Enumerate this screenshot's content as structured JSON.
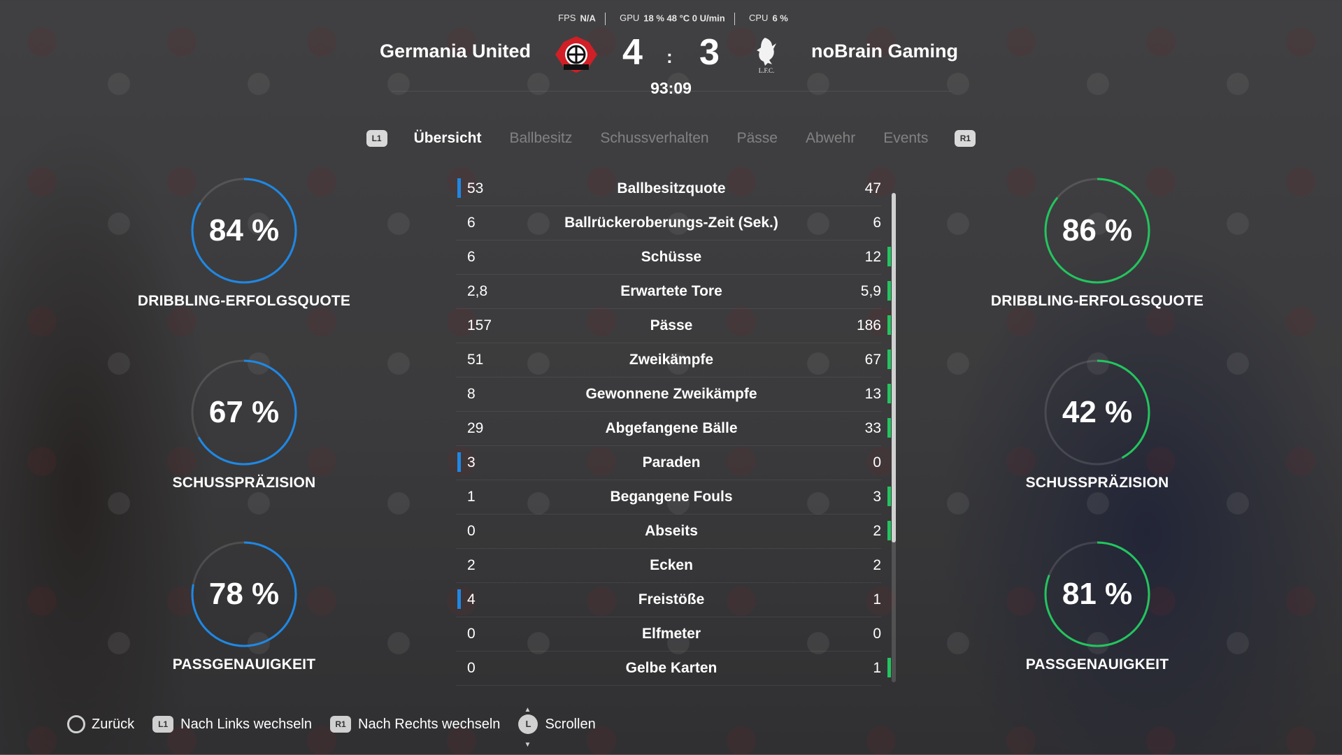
{
  "perf": {
    "fps_label": "FPS",
    "fps_value": "N/A",
    "gpu_label": "GPU",
    "gpu_value": "18 %  48 °C  0 U/min",
    "cpu_label": "CPU",
    "cpu_value": "6 %"
  },
  "match": {
    "home_team": "Germania United",
    "away_team": "noBrain Gaming",
    "home_score": "4",
    "away_score": "3",
    "separator": ":",
    "clock": "93:09",
    "home_crest_icon": "bayer-leverkusen-crest-icon",
    "away_crest_icon": "liverpool-liverbird-crest-icon",
    "away_crest_text": "L.F.C."
  },
  "tabs": {
    "left_button": "L1",
    "right_button": "R1",
    "items": [
      "Übersicht",
      "Ballbesitz",
      "Schussverhalten",
      "Pässe",
      "Abwehr",
      "Events"
    ],
    "active": "Übersicht"
  },
  "home_rings": [
    {
      "value": "84 %",
      "fraction": 0.84,
      "label": "DRIBBLING-ERFOLGSQUOTE"
    },
    {
      "value": "67 %",
      "fraction": 0.67,
      "label": "SCHUSSPRÄZISION"
    },
    {
      "value": "78 %",
      "fraction": 0.78,
      "label": "PASSGENAUIGKEIT"
    }
  ],
  "away_rings": [
    {
      "value": "86 %",
      "fraction": 0.86,
      "label": "DRIBBLING-ERFOLGSQUOTE"
    },
    {
      "value": "42 %",
      "fraction": 0.42,
      "label": "SCHUSSPRÄZISION"
    },
    {
      "value": "81 %",
      "fraction": 0.81,
      "label": "PASSGENAUIGKEIT"
    }
  ],
  "colors": {
    "home": "#1e88e5",
    "away": "#22c55e"
  },
  "stats": [
    {
      "name": "Ballbesitzquote",
      "home": "53",
      "away": "47",
      "leader": "home"
    },
    {
      "name": "Ballrückeroberungs-Zeit (Sek.)",
      "home": "6",
      "away": "6",
      "leader": ""
    },
    {
      "name": "Schüsse",
      "home": "6",
      "away": "12",
      "leader": "away"
    },
    {
      "name": "Erwartete Tore",
      "home": "2,8",
      "away": "5,9",
      "leader": "away"
    },
    {
      "name": "Pässe",
      "home": "157",
      "away": "186",
      "leader": "away"
    },
    {
      "name": "Zweikämpfe",
      "home": "51",
      "away": "67",
      "leader": "away"
    },
    {
      "name": "Gewonnene Zweikämpfe",
      "home": "8",
      "away": "13",
      "leader": "away"
    },
    {
      "name": "Abgefangene Bälle",
      "home": "29",
      "away": "33",
      "leader": "away"
    },
    {
      "name": "Paraden",
      "home": "3",
      "away": "0",
      "leader": "home"
    },
    {
      "name": "Begangene Fouls",
      "home": "1",
      "away": "3",
      "leader": "away"
    },
    {
      "name": "Abseits",
      "home": "0",
      "away": "2",
      "leader": "away"
    },
    {
      "name": "Ecken",
      "home": "2",
      "away": "2",
      "leader": ""
    },
    {
      "name": "Freistöße",
      "home": "4",
      "away": "1",
      "leader": "home"
    },
    {
      "name": "Elfmeter",
      "home": "0",
      "away": "0",
      "leader": ""
    },
    {
      "name": "Gelbe Karten",
      "home": "0",
      "away": "1",
      "leader": "away"
    }
  ],
  "footer": {
    "back_label": "Zurück",
    "left_button": "L1",
    "left_label": "Nach Links wechseln",
    "right_button": "R1",
    "right_label": "Nach Rechts wechseln",
    "stick_button": "L",
    "scroll_label": "Scrollen"
  }
}
